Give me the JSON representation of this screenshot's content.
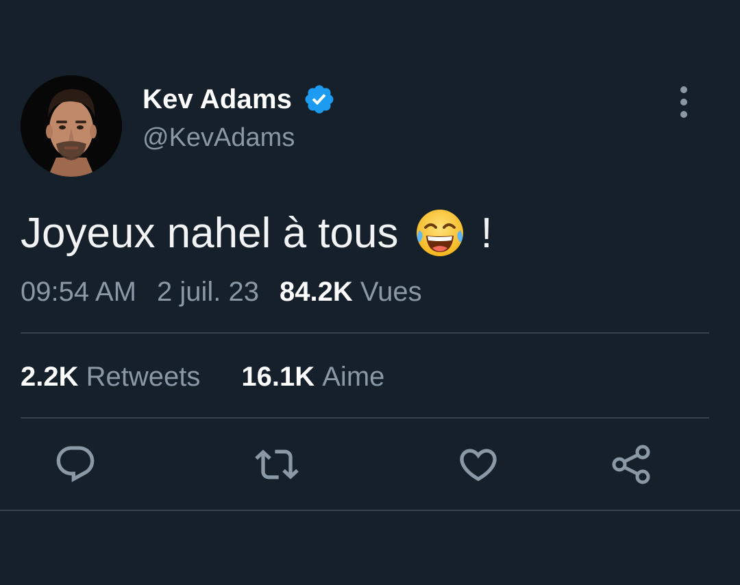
{
  "tweet": {
    "author": {
      "display_name": "Kev Adams",
      "handle": "@KevAdams",
      "verified_icon": "verified-badge-icon",
      "avatar": "profile-photo"
    },
    "menu_icon": "more-vertical-icon",
    "text": "Joyeux nahel à tous",
    "emoji": "face-with-tears-of-joy",
    "text_suffix": "!",
    "time": "09:54 AM",
    "date": "2 juil. 23",
    "views_count": "84.2K",
    "views_label": "Vues",
    "retweets_count": "2.2K",
    "retweets_label": "Retweets",
    "likes_count": "16.1K",
    "likes_label": "Aime",
    "actions": [
      {
        "name": "reply",
        "icon": "reply-icon"
      },
      {
        "name": "retweet",
        "icon": "retweet-icon"
      },
      {
        "name": "like",
        "icon": "heart-icon"
      },
      {
        "name": "share",
        "icon": "share-icon"
      }
    ]
  },
  "colors": {
    "background": "#15202b",
    "primary_text": "#ffffff",
    "secondary_text": "#8b98a5",
    "divider": "#38444d",
    "verified": "#1d9bf0"
  }
}
